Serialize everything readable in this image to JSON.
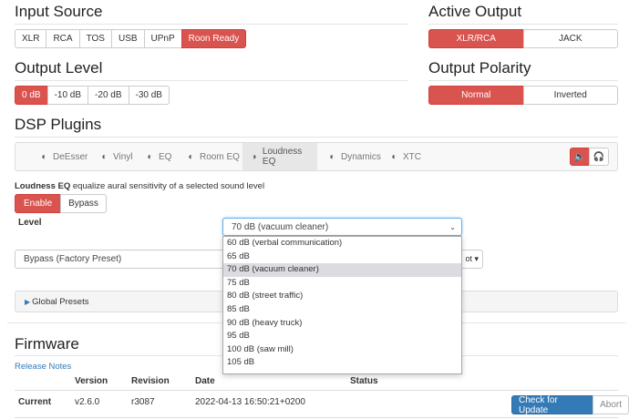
{
  "input_source": {
    "title": "Input Source",
    "buttons": [
      "XLR",
      "RCA",
      "TOS",
      "USB",
      "UPnP",
      "Roon Ready"
    ],
    "active": "Roon Ready"
  },
  "active_output": {
    "title": "Active Output",
    "buttons": [
      "XLR/RCA",
      "JACK"
    ],
    "active": "XLR/RCA"
  },
  "output_level": {
    "title": "Output Level",
    "buttons": [
      "0 dB",
      "-10 dB",
      "-20 dB",
      "-30 dB"
    ],
    "active": "0 dB"
  },
  "output_polarity": {
    "title": "Output Polarity",
    "buttons": [
      "Normal",
      "Inverted"
    ],
    "active": "Normal"
  },
  "dsp": {
    "title": "DSP Plugins",
    "tabs": [
      {
        "label": "DeEsser",
        "icon": "toggle-off-icon"
      },
      {
        "label": "Vinyl",
        "icon": "toggle-off-icon"
      },
      {
        "label": "EQ",
        "icon": "toggle-off-icon"
      },
      {
        "label": "Room EQ",
        "icon": "toggle-off-icon"
      },
      {
        "label": "Loudness EQ",
        "icon": "toggle-on-icon"
      },
      {
        "label": "Dynamics",
        "icon": "toggle-off-icon"
      },
      {
        "label": "XTC",
        "icon": "toggle-off-icon"
      }
    ],
    "active_tab": "Loudness EQ",
    "output_buttons": [
      {
        "icon": "speaker-icon",
        "glyph": "🔈"
      },
      {
        "icon": "headphones-icon",
        "glyph": "🎧"
      }
    ],
    "plugin_name": "Loudness EQ",
    "plugin_desc": "equalize aural sensitivity of a selected sound level",
    "mode_buttons": [
      "Enable",
      "Bypass"
    ],
    "mode_active": "Enable",
    "level_label": "Level",
    "level_value": "70 dB (vacuum cleaner)",
    "level_options": [
      "60 dB (verbal communication)",
      "65 dB",
      "70 dB (vacuum cleaner)",
      "75 dB",
      "80 dB (street traffic)",
      "85 dB",
      "90 dB (heavy truck)",
      "95 dB",
      "100 dB (saw mill)",
      "105 dB"
    ],
    "preset_value": "Bypass (Factory Preset)",
    "preset_side_label": "ot ▾",
    "global_presets_label": "Global Presets"
  },
  "firmware": {
    "title": "Firmware",
    "release_notes": "Release Notes",
    "headers": {
      "version": "Version",
      "revision": "Revision",
      "date": "Date",
      "status": "Status"
    },
    "row": {
      "name": "Current",
      "version": "v2.6.0",
      "revision": "r3087",
      "date": "2022-04-13 16:50:21+0200"
    },
    "check_button": "Check for Update",
    "abort_button": "Abort"
  },
  "colors": {
    "accent": "#d9534f",
    "primary": "#337ab7"
  }
}
